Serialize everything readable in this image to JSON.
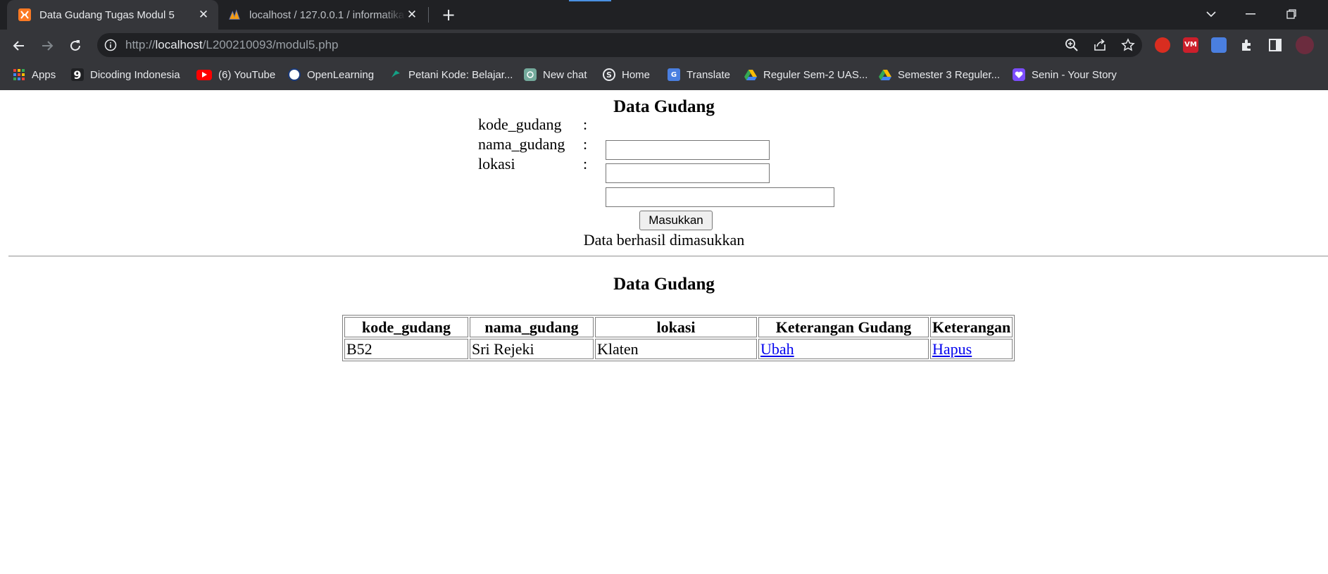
{
  "browser": {
    "tabs": [
      {
        "title": "Data Gudang Tugas Modul 5",
        "active": true,
        "icon": "xampp-icon"
      },
      {
        "title": "localhost / 127.0.0.1 / informatika",
        "active": false,
        "icon": "phpmyadmin-icon"
      }
    ],
    "url": {
      "scheme": "http://",
      "host": "localhost",
      "path": "/L200210093/modul5.php"
    },
    "bookmarks": [
      {
        "label": "Apps",
        "icon": "apps-grid-icon"
      },
      {
        "label": "Dicoding Indonesia",
        "icon": "dicoding-icon"
      },
      {
        "label": "(6) YouTube",
        "icon": "youtube-icon"
      },
      {
        "label": "OpenLearning",
        "icon": "openlearning-icon"
      },
      {
        "label": "Petani Kode: Belajar...",
        "icon": "petanikode-icon"
      },
      {
        "label": "New chat",
        "icon": "chatgpt-icon"
      },
      {
        "label": "Home",
        "icon": "skype-icon"
      },
      {
        "label": "Translate",
        "icon": "translate-icon"
      },
      {
        "label": "Reguler Sem-2 UAS...",
        "icon": "google-drive-icon"
      },
      {
        "label": "Semester 3 Reguler...",
        "icon": "google-drive-icon"
      },
      {
        "label": "Senin - Your Story",
        "icon": "heart-icon"
      }
    ]
  },
  "page": {
    "form_heading": "Data Gudang",
    "form": {
      "fields": [
        {
          "label": "kode_gudang",
          "colon": ":",
          "value": ""
        },
        {
          "label": "nama_gudang",
          "colon": ":",
          "value": ""
        },
        {
          "label": "lokasi",
          "colon": ":",
          "value": ""
        }
      ],
      "submit_label": "Masukkan",
      "status_message": "Data berhasil dimasukkan"
    },
    "table_heading": "Data Gudang",
    "table": {
      "columns": [
        "kode_gudang",
        "nama_gudang",
        "lokasi",
        "Keterangan Gudang",
        "Keterangan"
      ],
      "rows": [
        {
          "kode_gudang": "B52",
          "nama_gudang": "Sri Rejeki",
          "lokasi": "Klaten",
          "edit_link": "Ubah",
          "delete_link": "Hapus"
        }
      ]
    }
  }
}
